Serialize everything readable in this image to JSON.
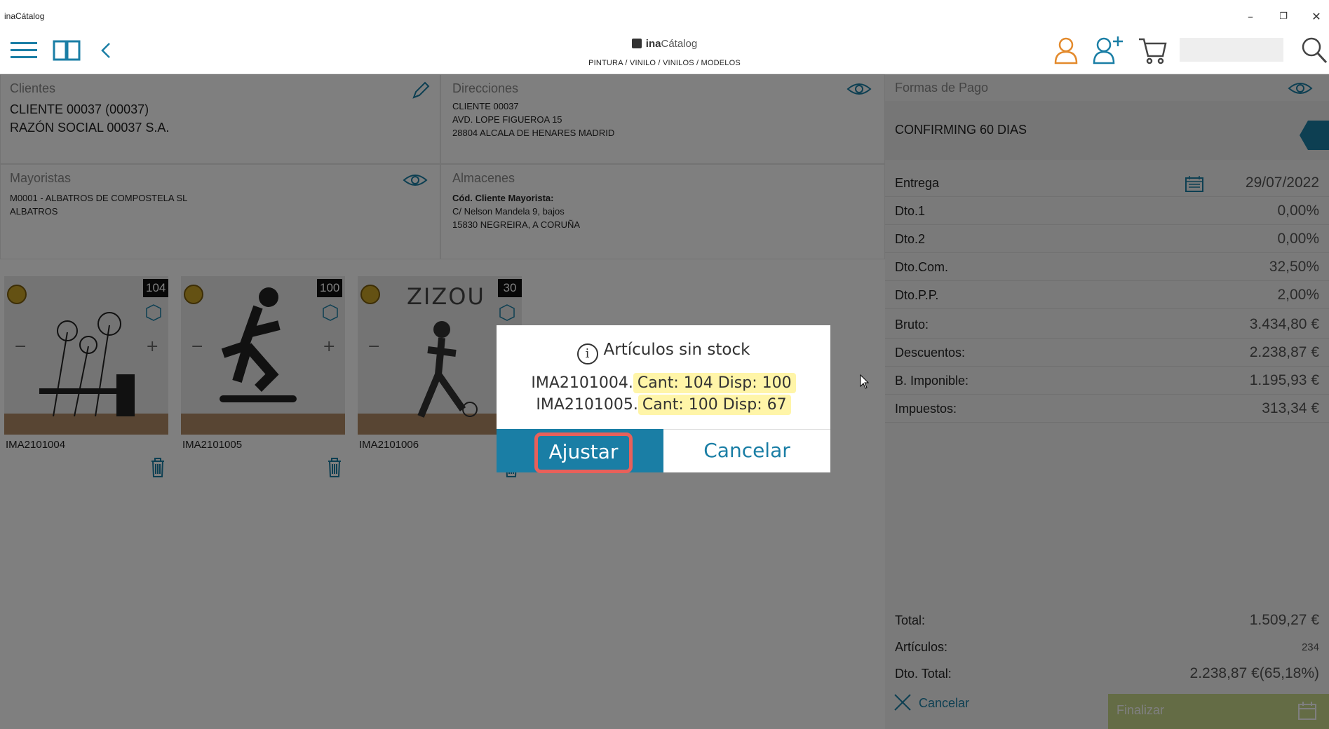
{
  "window": {
    "title": "inaCátalog",
    "minimize": "–",
    "restore": "❐",
    "close": "✕"
  },
  "header": {
    "logo_brand": "ina",
    "logo_rest": "Cátalog",
    "breadcrumb": "PINTURA / VINILO / VINILOS / MODELOS",
    "search_placeholder": ""
  },
  "clientes": {
    "title": "Clientes",
    "line1": "CLIENTE 00037 (00037)",
    "line2": "RAZÓN SOCIAL  00037 S.A."
  },
  "direcciones": {
    "title": "Direcciones",
    "line1": "CLIENTE 00037",
    "line2": "AVD. LOPE FIGUEROA 15",
    "line3": "28804 ALCALA DE HENARES MADRID"
  },
  "formas_pago": {
    "title": "Formas de Pago",
    "value": "CONFIRMING 60 DIAS"
  },
  "mayoristas": {
    "title": "Mayoristas",
    "line1": "M0001 - ALBATROS DE COMPOSTELA SL",
    "line2": "ALBATROS"
  },
  "almacenes": {
    "title": "Almacenes",
    "line1": "Cód. Cliente Mayorista:",
    "line2": "C/ Nelson Mandela 9, bajos",
    "line3": "15830 NEGREIRA, A CORUÑA"
  },
  "products": [
    {
      "code": "IMA2101004",
      "qty": "104",
      "minus": "−",
      "plus": "+"
    },
    {
      "code": "IMA2101005",
      "qty": "100",
      "minus": "−",
      "plus": "+"
    },
    {
      "code": "IMA2101006",
      "qty": "30",
      "minus": "−",
      "plus": "+",
      "art_text": "ZIZOU"
    }
  ],
  "summary": {
    "entrega_label": "Entrega",
    "entrega_date": "29/07/2022",
    "rows": [
      {
        "label": "Dto.1",
        "value": "0,00%"
      },
      {
        "label": "Dto.2",
        "value": "0,00%"
      },
      {
        "label": "Dto.Com.",
        "value": "32,50%"
      },
      {
        "label": "Dto.P.P.",
        "value": "2,00%"
      },
      {
        "label": "Bruto:",
        "value": "3.434,80 €"
      },
      {
        "label": "Descuentos:",
        "value": "2.238,87 €"
      },
      {
        "label": "B. Imponible:",
        "value": "1.195,93 €"
      },
      {
        "label": "Impuestos:",
        "value": "313,34 €"
      }
    ],
    "total_label": "Total:",
    "total_value": "1.509,27 €",
    "articulos_label": "Artículos:",
    "articulos_value": "234",
    "dto_total_label": "Dto. Total:",
    "dto_total_value": "2.238,87 €(65,18%)",
    "cancel_label": "Cancelar",
    "finalizar_label": "Finalizar"
  },
  "dialog": {
    "title": "Artículos sin stock",
    "info_glyph": "i",
    "line1_code": "IMA2101004.",
    "line1_detail": "Cant: 104 Disp: 100",
    "line2_code": "IMA2101005.",
    "line2_detail": "Cant: 100 Disp: 67",
    "adjust_label": "Ajustar",
    "cancel_label": "Cancelar"
  },
  "colors": {
    "accent": "#1a7ea5",
    "highlight": "#fff5a8",
    "focus_ring": "#e8605a",
    "finalizar": "#c8d88a"
  }
}
